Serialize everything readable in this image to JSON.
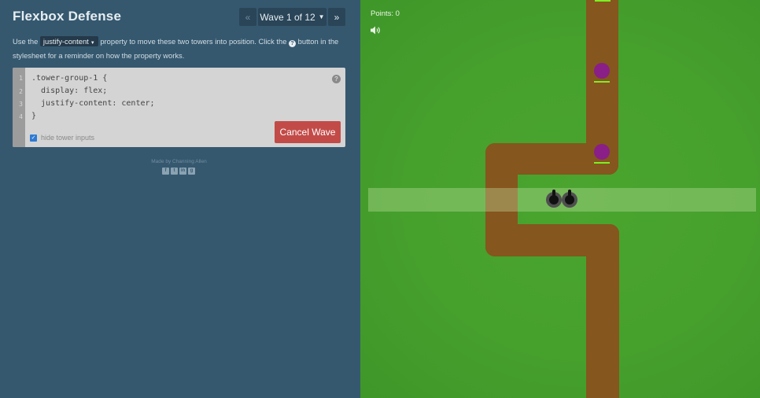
{
  "header": {
    "title": "Flexbox Defense",
    "prev_label": "«",
    "wave_label": "Wave 1 of 12",
    "next_label": "»"
  },
  "instructions": {
    "prefix": "Use the",
    "property": "justify-content",
    "middle": "property to move these two towers into position. Click the",
    "suffix": "button in the stylesheet for a reminder on how the property works."
  },
  "editor": {
    "line_numbers": [
      "1",
      "2",
      "3",
      "4"
    ],
    "lines": [
      ".tower-group-1 {",
      "  display: flex;",
      "  justify-content: center;",
      "}"
    ],
    "cancel_label": "Cancel Wave",
    "hide_label": "hide tower inputs",
    "hide_checked": true
  },
  "footer": {
    "made_by": "Made by Channing Allen",
    "social_icons": [
      "facebook-icon",
      "twitter-icon",
      "linkedin-icon",
      "github-icon"
    ]
  },
  "game": {
    "points_label": "Points: 0",
    "colors": {
      "grass": "#46a02c",
      "path": "#85561d",
      "enemy": "#8a1f87",
      "health": "#7cf024",
      "tower": "#111111"
    }
  }
}
